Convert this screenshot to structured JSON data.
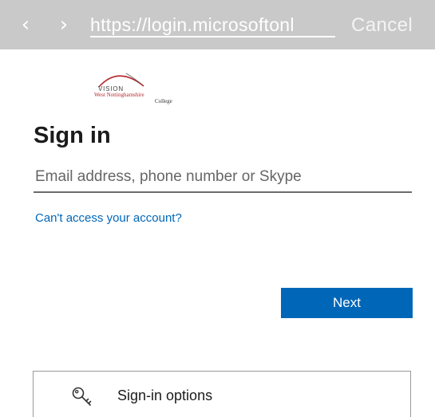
{
  "browser": {
    "back_icon": "chevron-left-icon",
    "back_glyph": "‹",
    "forward_icon": "chevron-right-icon",
    "forward_glyph": "›",
    "url": "https://login.microsoftonl",
    "cancel_label": "Cancel"
  },
  "logo": {
    "vision_text": "VISION",
    "college_name": "West Nottinghamshire",
    "college_suffix": "College",
    "accent_color": "#b42a2f"
  },
  "signin": {
    "title": "Sign in",
    "email_placeholder": "Email address, phone number or Skype",
    "email_value": "",
    "cant_access_link": "Can't access your account?",
    "next_label": "Next"
  },
  "options": {
    "icon": "key-icon",
    "label": "Sign-in options"
  },
  "colors": {
    "accent": "#0067b8",
    "topbar_background": "#c9c9c9",
    "text": "#1b1b1b"
  }
}
